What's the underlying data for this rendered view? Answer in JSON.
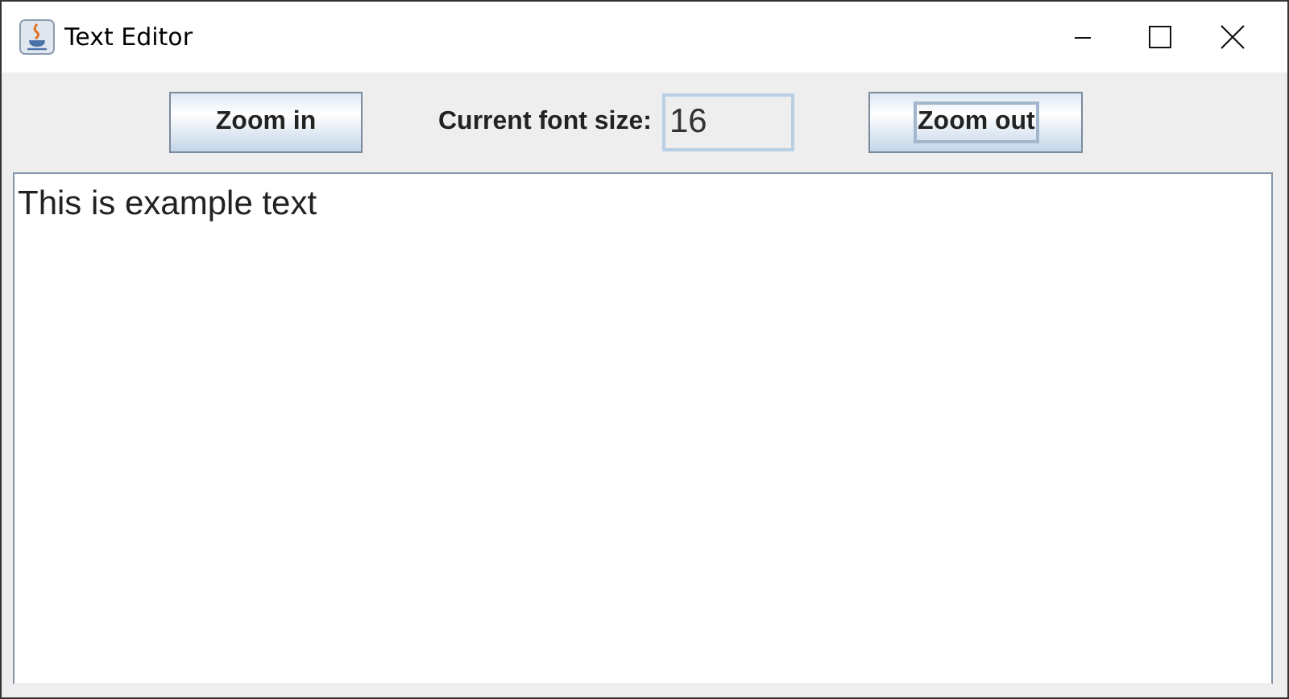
{
  "window": {
    "title": "Text Editor"
  },
  "toolbar": {
    "buttons": [
      {
        "label": "Zoom in",
        "focused": false
      },
      {
        "label": "Zoom out",
        "focused": true
      }
    ],
    "font_size_label": "Current font size:",
    "font_size_value": "16"
  },
  "editor": {
    "text": "This is example text"
  }
}
